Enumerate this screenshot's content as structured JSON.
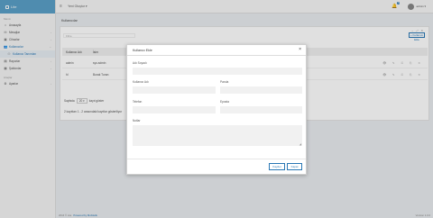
{
  "brand": {
    "title": "Lite"
  },
  "topbar": {
    "menu_label": "Yeni Oluştur ▾",
    "notif_count": "6",
    "user": "admin ▾"
  },
  "sidebar": {
    "section_main": "Menü",
    "items": [
      {
        "label": "Anasayfa",
        "icon": "home-icon"
      },
      {
        "label": "Mesajlar",
        "icon": "mail-icon"
      },
      {
        "label": "Cihazlar",
        "icon": "device-icon"
      },
      {
        "label": "Kullanıcılar",
        "icon": "users-icon"
      },
      {
        "label": "Kullanıcı Tanımları",
        "icon": "user-def-icon"
      },
      {
        "label": "Raporlar",
        "icon": "report-icon"
      },
      {
        "label": "Şablonlar",
        "icon": "template-icon"
      }
    ],
    "section_tools": "Araçlar",
    "tools_items": [
      {
        "label": "Ayarlar",
        "icon": "gear-icon"
      }
    ]
  },
  "page": {
    "title": "Kullanıcılar",
    "filter_placeholder": "Filtre",
    "add_button": "+ Kullanıcı Ekle",
    "columns": [
      "Kullanıcı Adı",
      "İsim"
    ],
    "rows": [
      {
        "username": "admin",
        "name": "sys admin"
      },
      {
        "username": "hl",
        "name": "Burak Turan"
      }
    ],
    "page_size_prefix": "Sayfada",
    "page_size": "20 ▾",
    "page_size_suffix": "kayıt göster",
    "info": "2 kayıttan 1 - 2 arasındaki kayıtlar gösteriliyor"
  },
  "modal": {
    "title": "Kullanıcı Ekle",
    "fields": {
      "full_name": "Adı Soyadı",
      "username": "Kullanıcı Adı",
      "password": "Parola",
      "phone": "Telefon",
      "email": "Eposta",
      "notes": "Notlar"
    },
    "save": "Kaydet",
    "close": "Kapat"
  },
  "footer": {
    "copyright": "2016 © Lite",
    "powered": "Powered by Mobiletik",
    "version": "Version 1.0.0"
  }
}
